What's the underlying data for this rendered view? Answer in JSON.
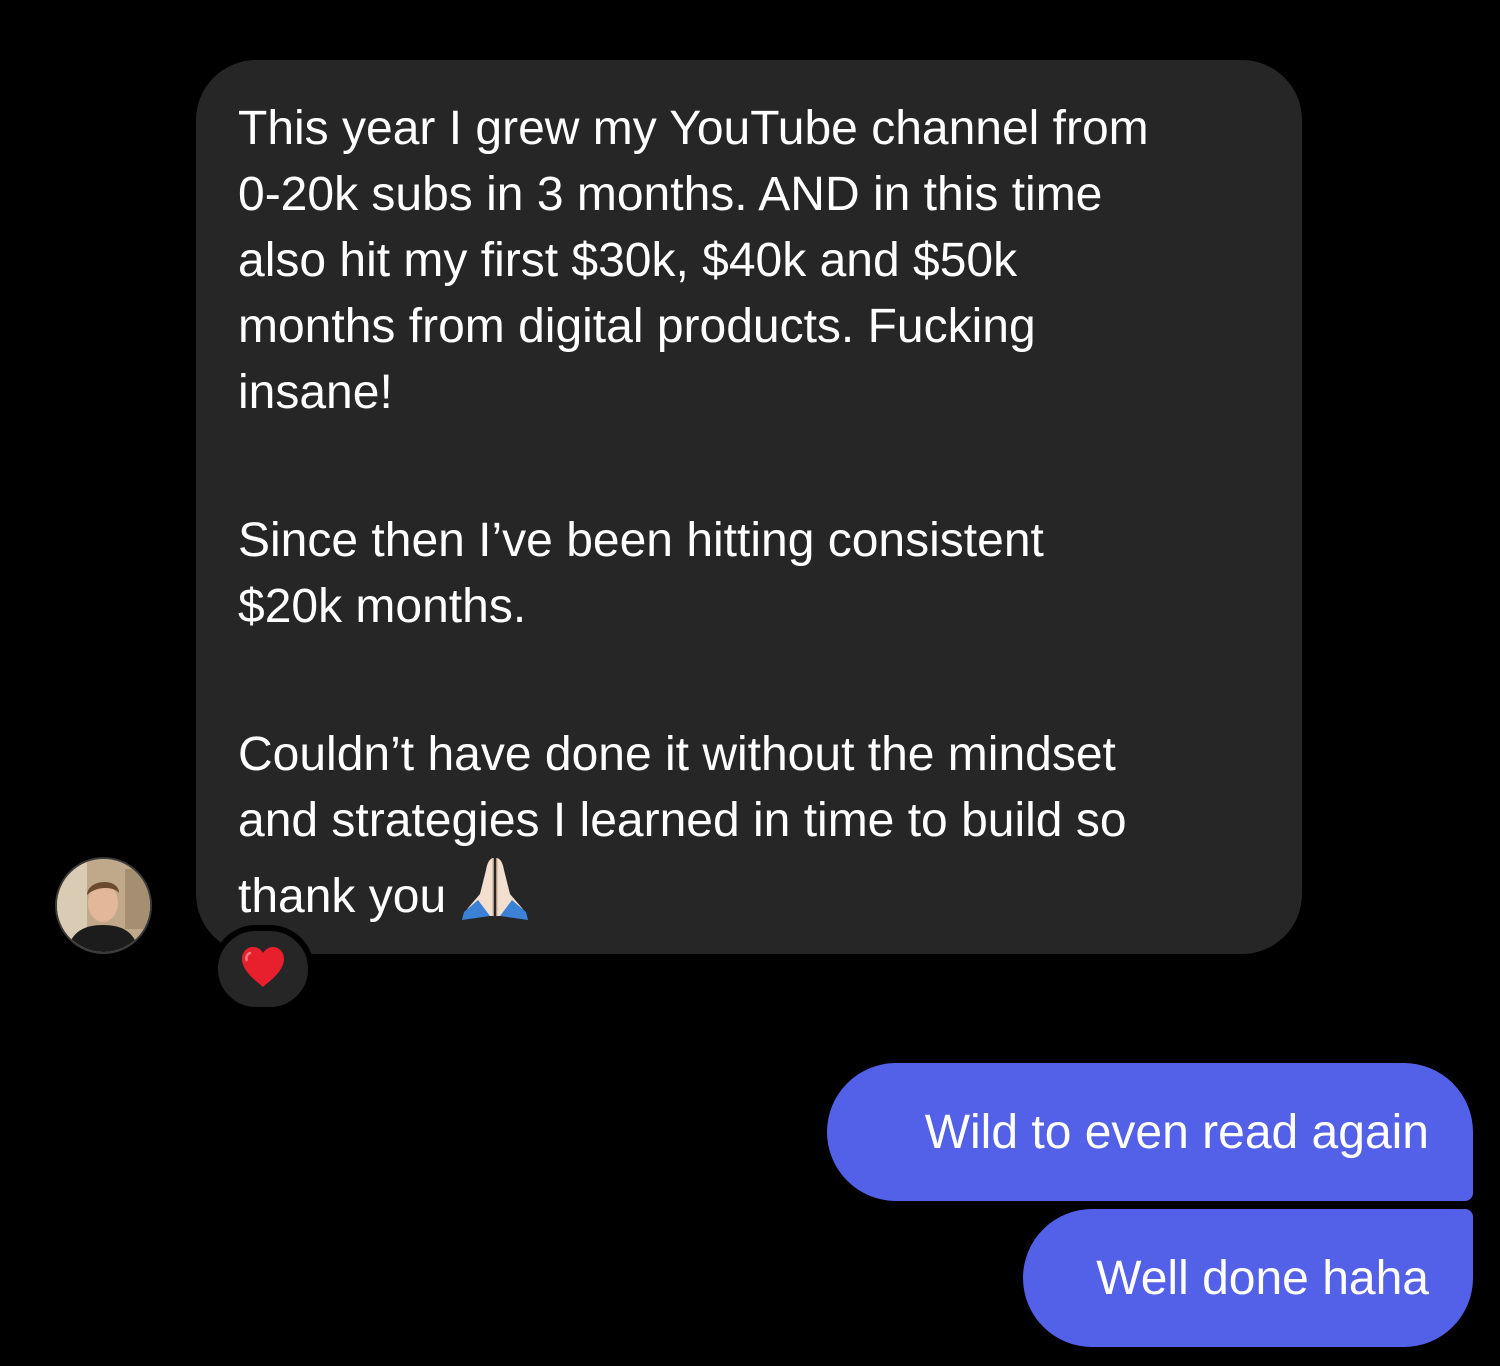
{
  "thread": {
    "incoming_message": {
      "paragraphs": [
        "This year I grew my YouTube channel from\n0-20k subs in 3 months. AND in this time\nalso hit my first $30k, $40k and $50k\nmonths from digital products. Fucking\ninsane!",
        "Since then I’ve been hitting consistent\n$20k months.",
        "Couldn’t have done it without the mindset\nand strategies I learned in time to build so\nthank you"
      ],
      "trailing_emoji": "folded-hands-icon",
      "reaction": "red-heart-icon"
    },
    "outgoing_messages": [
      "Wild to even read again",
      "Well done haha"
    ]
  },
  "colors": {
    "background": "#000000",
    "incoming_bubble": "#262626",
    "outgoing_bubble": "#5360e8",
    "text": "#ffffff",
    "heart": "#e8202e"
  }
}
